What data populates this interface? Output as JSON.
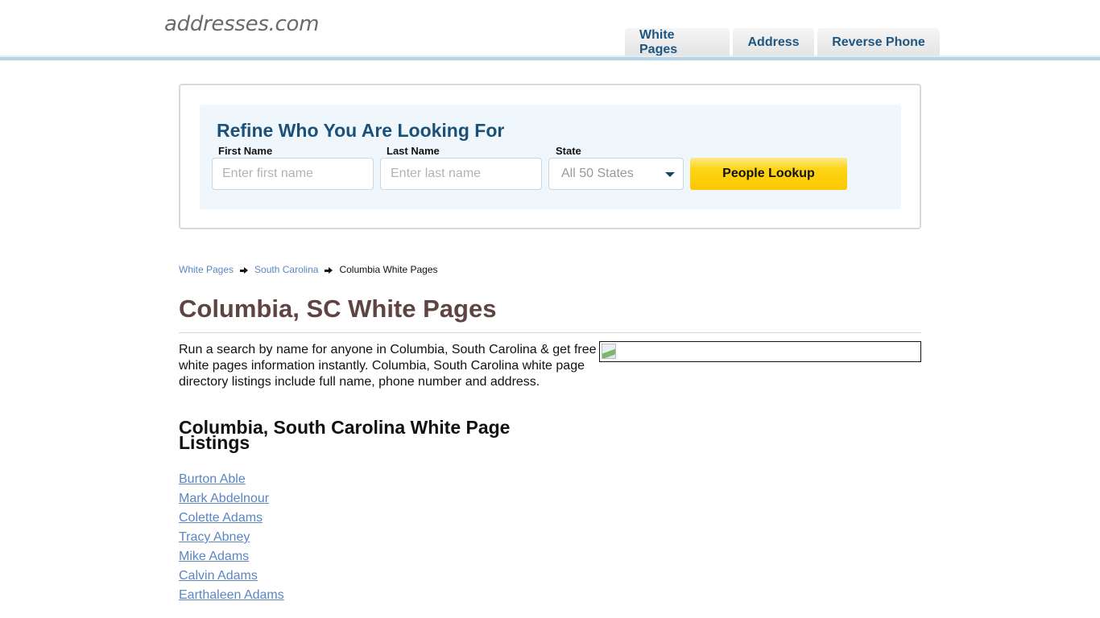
{
  "header": {
    "logo": "addresses.com",
    "nav": [
      {
        "label": "White Pages"
      },
      {
        "label": "Address"
      },
      {
        "label": "Reverse Phone"
      }
    ]
  },
  "search": {
    "title": "Refine Who You Are Looking For",
    "first_name": {
      "label": "First Name",
      "placeholder": "Enter first name",
      "value": ""
    },
    "last_name": {
      "label": "Last Name",
      "placeholder": "Enter last name",
      "value": ""
    },
    "state": {
      "label": "State",
      "selected": "All 50 States"
    },
    "submit_label": "People Lookup"
  },
  "breadcrumb": {
    "items": [
      {
        "label": "White Pages"
      },
      {
        "label": "South Carolina"
      },
      {
        "label": "Columbia White Pages"
      }
    ]
  },
  "page": {
    "title": "Columbia, SC White Pages",
    "intro": "Run a search by name for anyone in Columbia, South Carolina & get free white pages information instantly. Columbia, South Carolina white page directory listings include full name, phone number and address.",
    "listings_title": "Columbia, South Carolina White Page Listings",
    "listings": [
      {
        "name": "Burton Able"
      },
      {
        "name": "Mark Abdelnour"
      },
      {
        "name": "Colette Adams"
      },
      {
        "name": "Tracy Abney"
      },
      {
        "name": "Mike Adams"
      },
      {
        "name": "Calvin Adams"
      },
      {
        "name": "Earthaleen Adams"
      }
    ]
  },
  "colors": {
    "brand_blue": "#1b5078",
    "link_blue": "#5a86c4",
    "title_brown": "#5e4443",
    "button_yellow": "#fdd415",
    "header_rule": "#b7d3e6"
  }
}
